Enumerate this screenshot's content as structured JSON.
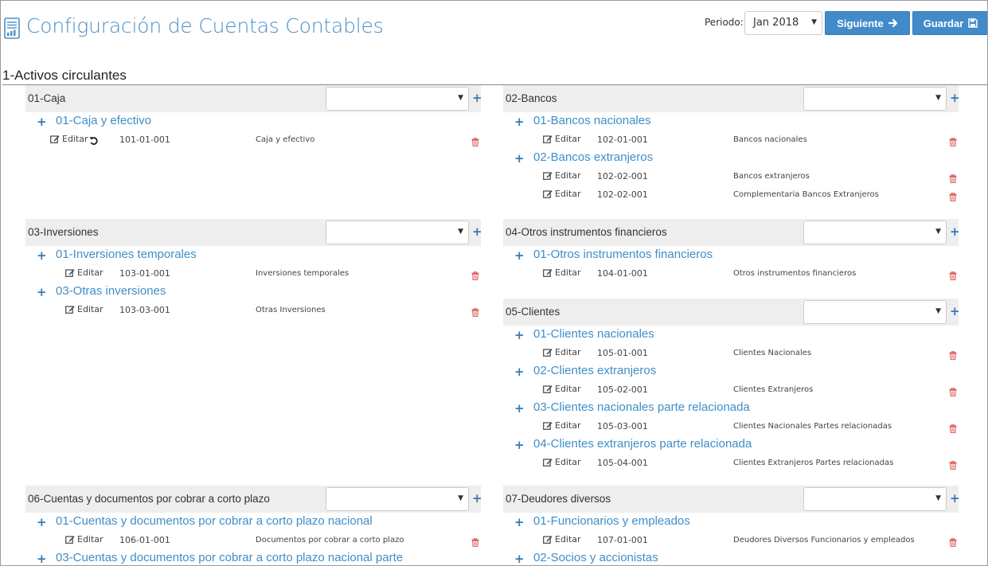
{
  "header": {
    "title": "Configuración de Cuentas Contables",
    "title_icon": "ledger-report-icon",
    "period_label": "Periodo:",
    "period_value": "Jan 2018",
    "next_label": "Siguiente",
    "save_label": "Guardar",
    "accent_color": "#428bca"
  },
  "section": {
    "title": "1-Activos circulantes"
  },
  "account_edit_label": "Editar",
  "panels": [
    {
      "title": "01-Caja",
      "subgroups": [
        {
          "label": "01-Caja y efectivo",
          "accounts": [
            {
              "code": "101-01-001",
              "description": "Caja y efectivo",
              "undo": true
            }
          ]
        }
      ]
    },
    {
      "title": "02-Bancos",
      "subgroups": [
        {
          "label": "01-Bancos nacionales",
          "accounts": [
            {
              "code": "102-01-001",
              "description": "Bancos nacionales"
            }
          ]
        },
        {
          "label": "02-Bancos extranjeros",
          "accounts": [
            {
              "code": "102-02-001",
              "description": "Bancos extranjeros"
            },
            {
              "code": "102-02-001",
              "description": "Complementaria Bancos Extranjeros"
            }
          ]
        }
      ]
    },
    {
      "title": "03-Inversiones",
      "subgroups": [
        {
          "label": "01-Inversiones temporales",
          "accounts": [
            {
              "code": "103-01-001",
              "description": "Inversiones temporales"
            }
          ]
        },
        {
          "label": "03-Otras inversiones",
          "accounts": [
            {
              "code": "103-03-001",
              "description": "Otras Inversiones"
            }
          ]
        }
      ]
    },
    {
      "title": "04-Otros instrumentos financieros",
      "subgroups": [
        {
          "label": "01-Otros instrumentos financieros",
          "accounts": [
            {
              "code": "104-01-001",
              "description": "Otros instrumentos financieros"
            }
          ]
        }
      ]
    },
    {
      "title": "05-Clientes",
      "subgroups": [
        {
          "label": "01-Clientes nacionales",
          "accounts": [
            {
              "code": "105-01-001",
              "description": "Clientes Nacionales"
            }
          ]
        },
        {
          "label": "02-Clientes extranjeros",
          "accounts": [
            {
              "code": "105-02-001",
              "description": "Clientes Extranjeros"
            }
          ]
        },
        {
          "label": "03-Clientes nacionales parte relacionada",
          "accounts": [
            {
              "code": "105-03-001",
              "description": "Clientes Nacionales Partes relacionadas"
            }
          ]
        },
        {
          "label": "04-Clientes extranjeros parte relacionada",
          "accounts": [
            {
              "code": "105-04-001",
              "description": "Clientes Extranjeros Partes relacionadas"
            }
          ]
        }
      ]
    },
    {
      "title": "06-Cuentas y documentos por cobrar a corto plazo",
      "subgroups": [
        {
          "label": "01-Cuentas y documentos por cobrar a corto plazo nacional",
          "accounts": [
            {
              "code": "106-01-001",
              "description": "Documentos por cobrar a corto plazo"
            }
          ]
        },
        {
          "label": "03-Cuentas y documentos por cobrar a corto plazo nacional parte",
          "accounts": []
        }
      ]
    },
    {
      "title": "07-Deudores diversos",
      "subgroups": [
        {
          "label": "01-Funcionarios y empleados",
          "accounts": [
            {
              "code": "107-01-001",
              "description": "Deudores Diversos Funcionarios y empleados"
            }
          ]
        },
        {
          "label": "02-Socios y accionistas",
          "accounts": []
        }
      ]
    }
  ]
}
